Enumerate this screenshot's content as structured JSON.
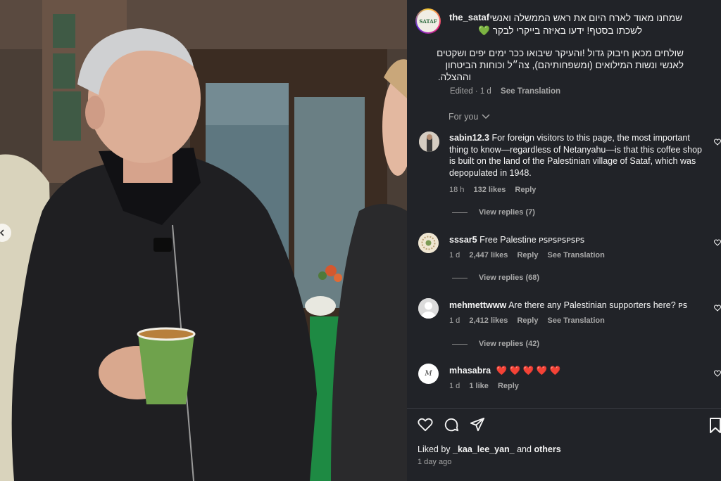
{
  "post": {
    "author": "the_sataf",
    "author_avatar_text": "SATAF",
    "caption_line1": "שמחנו מאוד לארח היום את ראש הממשלה ואנשי",
    "caption_line2": "לשכתו בסטף! ידעו באיזה בייקרי לבקר 💚",
    "caption_para2_line1": "שולחים מכאן חיבוק גדול !והעיקר שיבואו ככר ימים יפים ושקטים",
    "caption_para2_line2": "לאנשי ונשות המילואים (ומשפחותיהם), צה״ל וכוחות הביטחון",
    "caption_para2_line3": "וההצלה.",
    "edited": "Edited · 1 d",
    "see_translation": "See Translation",
    "for_you": "For you"
  },
  "comments": [
    {
      "user": "sabin12.3",
      "text": "For foreign visitors to this page, the most important thing to know—regardless of Netanyahu—is that this coffee shop is built on the land of the Palestinian village of Sataf, which was depopulated in 1948.",
      "time": "18 h",
      "likes": "132 likes",
      "reply": "Reply",
      "view_replies": "View replies (7)"
    },
    {
      "user": "sssar5",
      "text": "Free Palestine ᴘꜱᴘꜱᴘꜱᴘꜱᴘꜱ",
      "time": "1 d",
      "likes": "2,447 likes",
      "reply": "Reply",
      "translation": "See Translation",
      "view_replies": "View replies (68)"
    },
    {
      "user": "mehmettwww",
      "text": "Are there any Palestinian supporters here? ᴘꜱ",
      "time": "1 d",
      "likes": "2,412 likes",
      "reply": "Reply",
      "translation": "See Translation",
      "view_replies": "View replies (42)"
    },
    {
      "user": "mhasabra",
      "text": "❤️ ❤️ ❤️ ❤️ ❤️",
      "time": "1 d",
      "likes": "1 like",
      "reply": "Reply"
    }
  ],
  "footer": {
    "liked_by_prefix": "Liked by ",
    "liked_by_user": "_kaa_lee_yan_",
    "liked_by_and": " and ",
    "liked_by_others": "others",
    "date": "1 day ago"
  },
  "colors": {
    "panel_bg": "#212328",
    "heart_red": "#e8175d",
    "muted": "#a8a8a8"
  }
}
